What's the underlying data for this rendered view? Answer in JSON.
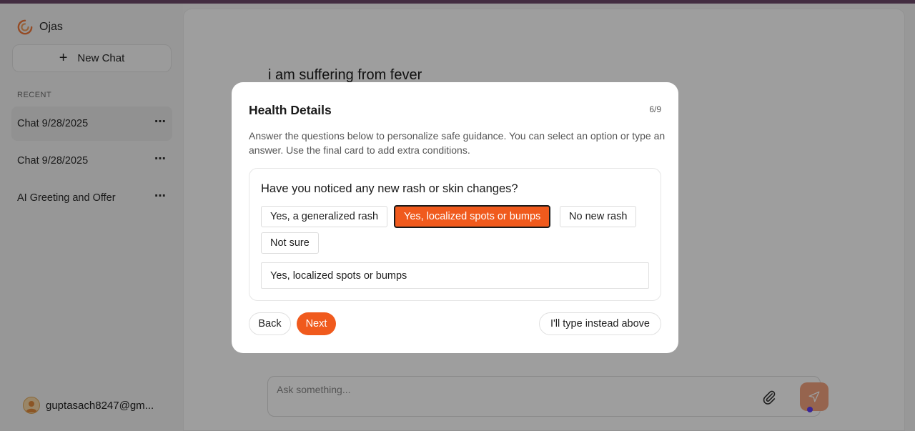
{
  "app": {
    "name": "Ojas"
  },
  "sidebar": {
    "new_chat_label": "New Chat",
    "recent_label": "RECENT",
    "chats": [
      {
        "title": "Chat 9/28/2025",
        "active": true
      },
      {
        "title": "Chat 9/28/2025",
        "active": false
      },
      {
        "title": "AI Greeting and Offer",
        "active": false
      }
    ],
    "more_icon": "⋯",
    "user_email": "guptasach8247@gm..."
  },
  "conversation": {
    "user_message": "i am suffering from fever"
  },
  "composer": {
    "placeholder": "Ask something..."
  },
  "modal": {
    "title": "Health Details",
    "step": "6/9",
    "description": "Answer the questions below to personalize safe guidance. You can select an option or type an answer. Use the final card to add extra conditions.",
    "question": "Have you noticed any new rash or skin changes?",
    "options": [
      "Yes, a generalized rash",
      "Yes, localized spots or bumps",
      "No new rash",
      "Not sure"
    ],
    "selected_option": "Yes, localized spots or bumps",
    "answer_value": "Yes, localized spots or bumps",
    "back_label": "Back",
    "next_label": "Next",
    "type_instead_label": "I'll type instead above"
  },
  "colors": {
    "accent": "#f05a1d",
    "send_button_disabled": "#f3a27e",
    "status_dot": "#5b3df5"
  }
}
